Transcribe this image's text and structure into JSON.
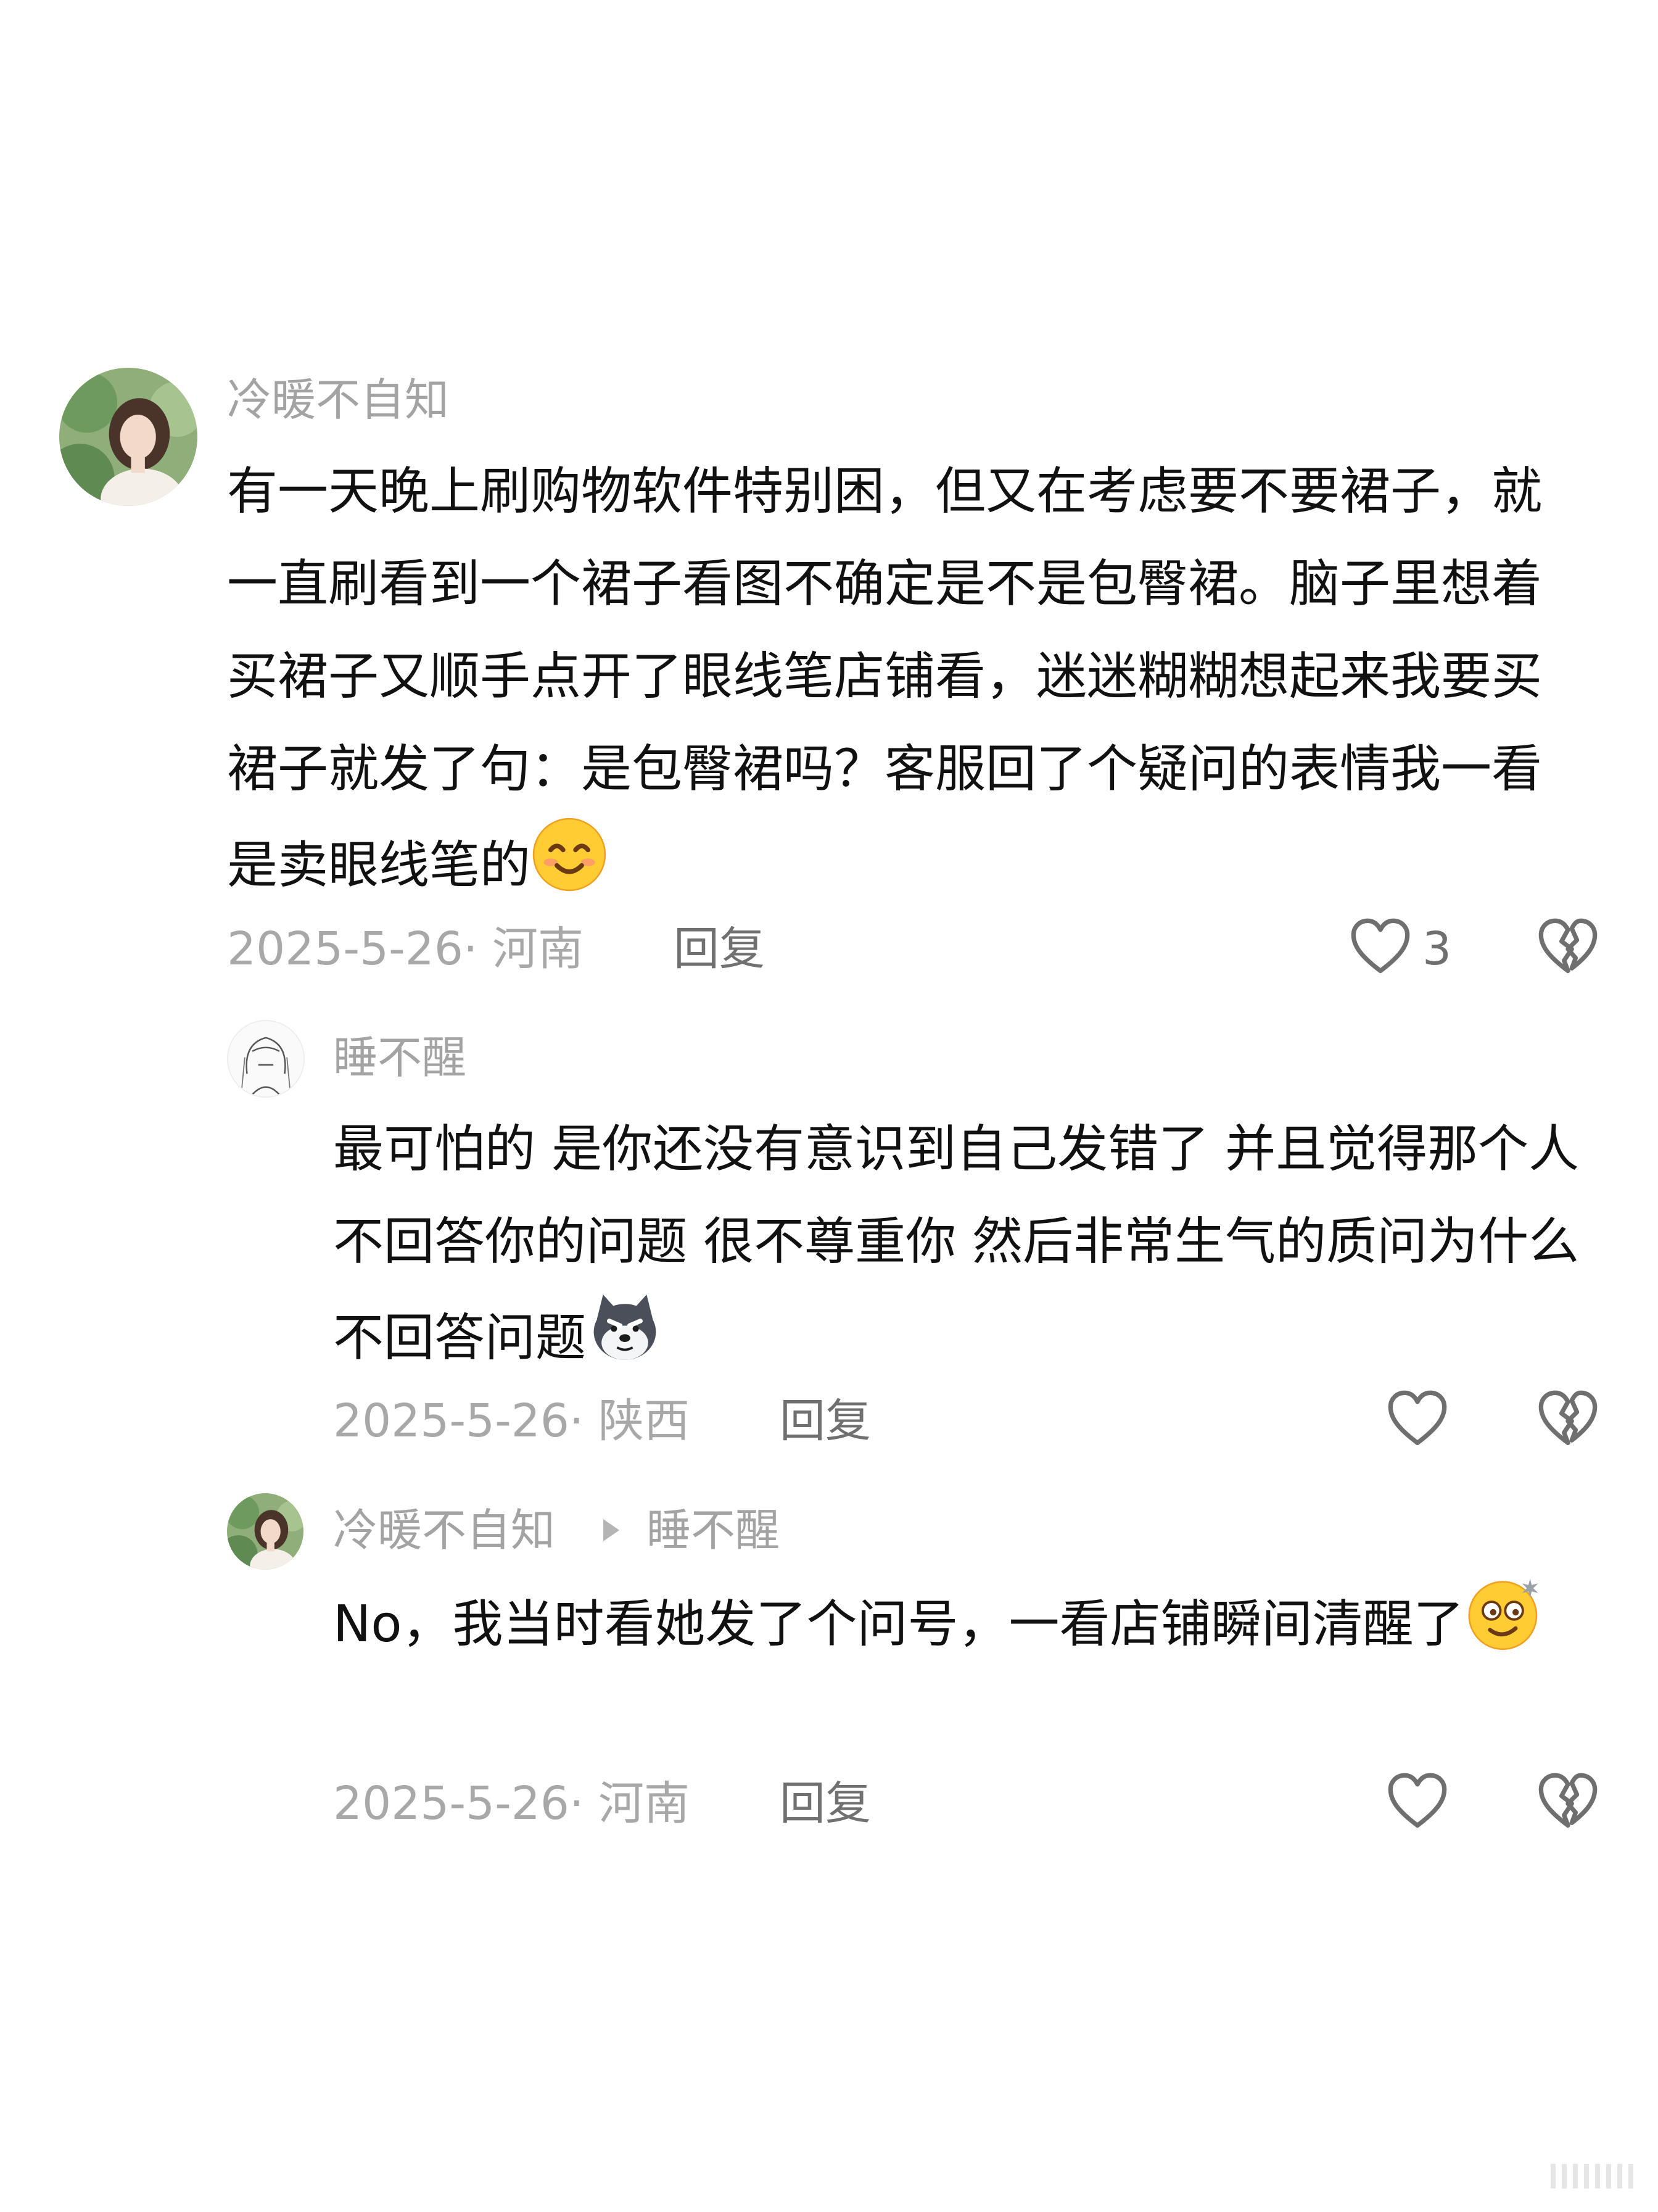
{
  "comments": [
    {
      "username": "冷暖不自知",
      "avatar": "girl-photo-avatar",
      "text": "有一天晚上刷购物软件特别困，但又在考虑要不要裙子，就一直刷看到一个裙子看图不确定是不是包臀裙。脑子里想着买裙子又顺手点开了眼线笔店铺看，迷迷糊糊想起来我要买裙子就发了句：是包臀裙吗？客服回了个疑问的表情我一看是卖眼线笔的",
      "emoji": "smiling-face-emoji",
      "date_location": "2025-5-26· 河南",
      "reply_label": "回复",
      "like_count": "3"
    }
  ],
  "replies": [
    {
      "username": "睡不醒",
      "avatar": "sketch-girl-avatar",
      "text": "最可怕的 是你还没有意识到自己发错了 并且觉得那个人不回答你的问题 很不尊重你 然后非常生气的质问为什么不回答问题",
      "emoji": "husky-dog-emoji",
      "date_location": "2025-5-26· 陕西",
      "reply_label": "回复"
    },
    {
      "username": "冷暖不自知",
      "reply_to": "睡不醒",
      "avatar": "girl-photo-avatar",
      "text": "No，我当时看她发了个问号，一看店铺瞬间清醒了",
      "emoji": "dizzy-face-emoji",
      "date_location": "2025-5-26· 河南",
      "reply_label": "回复"
    }
  ],
  "icons": {
    "like": "heart-outline-icon",
    "dislike": "broken-heart-icon",
    "reply_arrow": "triangle-arrow-icon"
  },
  "colors": {
    "text": "#111111",
    "meta": "#a8a8a8",
    "username": "#a3a3a3"
  }
}
